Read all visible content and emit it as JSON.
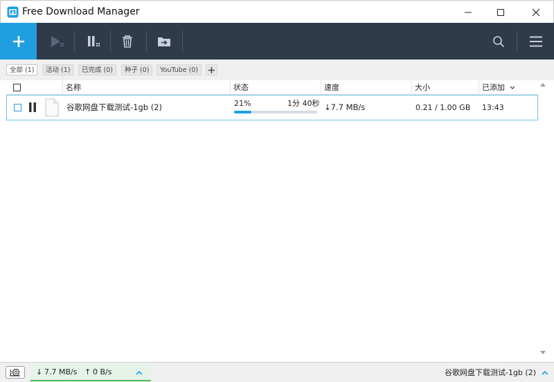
{
  "window": {
    "title": "Free Download Manager"
  },
  "filters": [
    {
      "label": "全部 (1)",
      "active": true
    },
    {
      "label": "活动 (1)",
      "active": false
    },
    {
      "label": "已完成 (0)",
      "active": false
    },
    {
      "label": "种子 (0)",
      "active": false
    },
    {
      "label": "YouTube (0)",
      "active": false
    }
  ],
  "table": {
    "columns": {
      "name": "名称",
      "status": "状态",
      "speed": "速度",
      "size": "大小",
      "added": "已添加"
    },
    "rows": [
      {
        "name": "谷歌网盘下载测试-1gb (2)",
        "progress_text": "21%",
        "progress": 0.21,
        "eta": "1分 40秒",
        "speed": "↓7.7 MB/s",
        "size": "0.21 / 1.00 GB",
        "added": "13:43"
      }
    ]
  },
  "statusbar": {
    "down_speed": "7.7 MB/s",
    "up_speed": "0 B/s",
    "current_file": "谷歌网盘下载测试-1gb (2)"
  },
  "colors": {
    "accent": "#1f9fe0",
    "toolbar_bg": "#2f3a4a",
    "speed_ok": "#4bbf5a"
  }
}
